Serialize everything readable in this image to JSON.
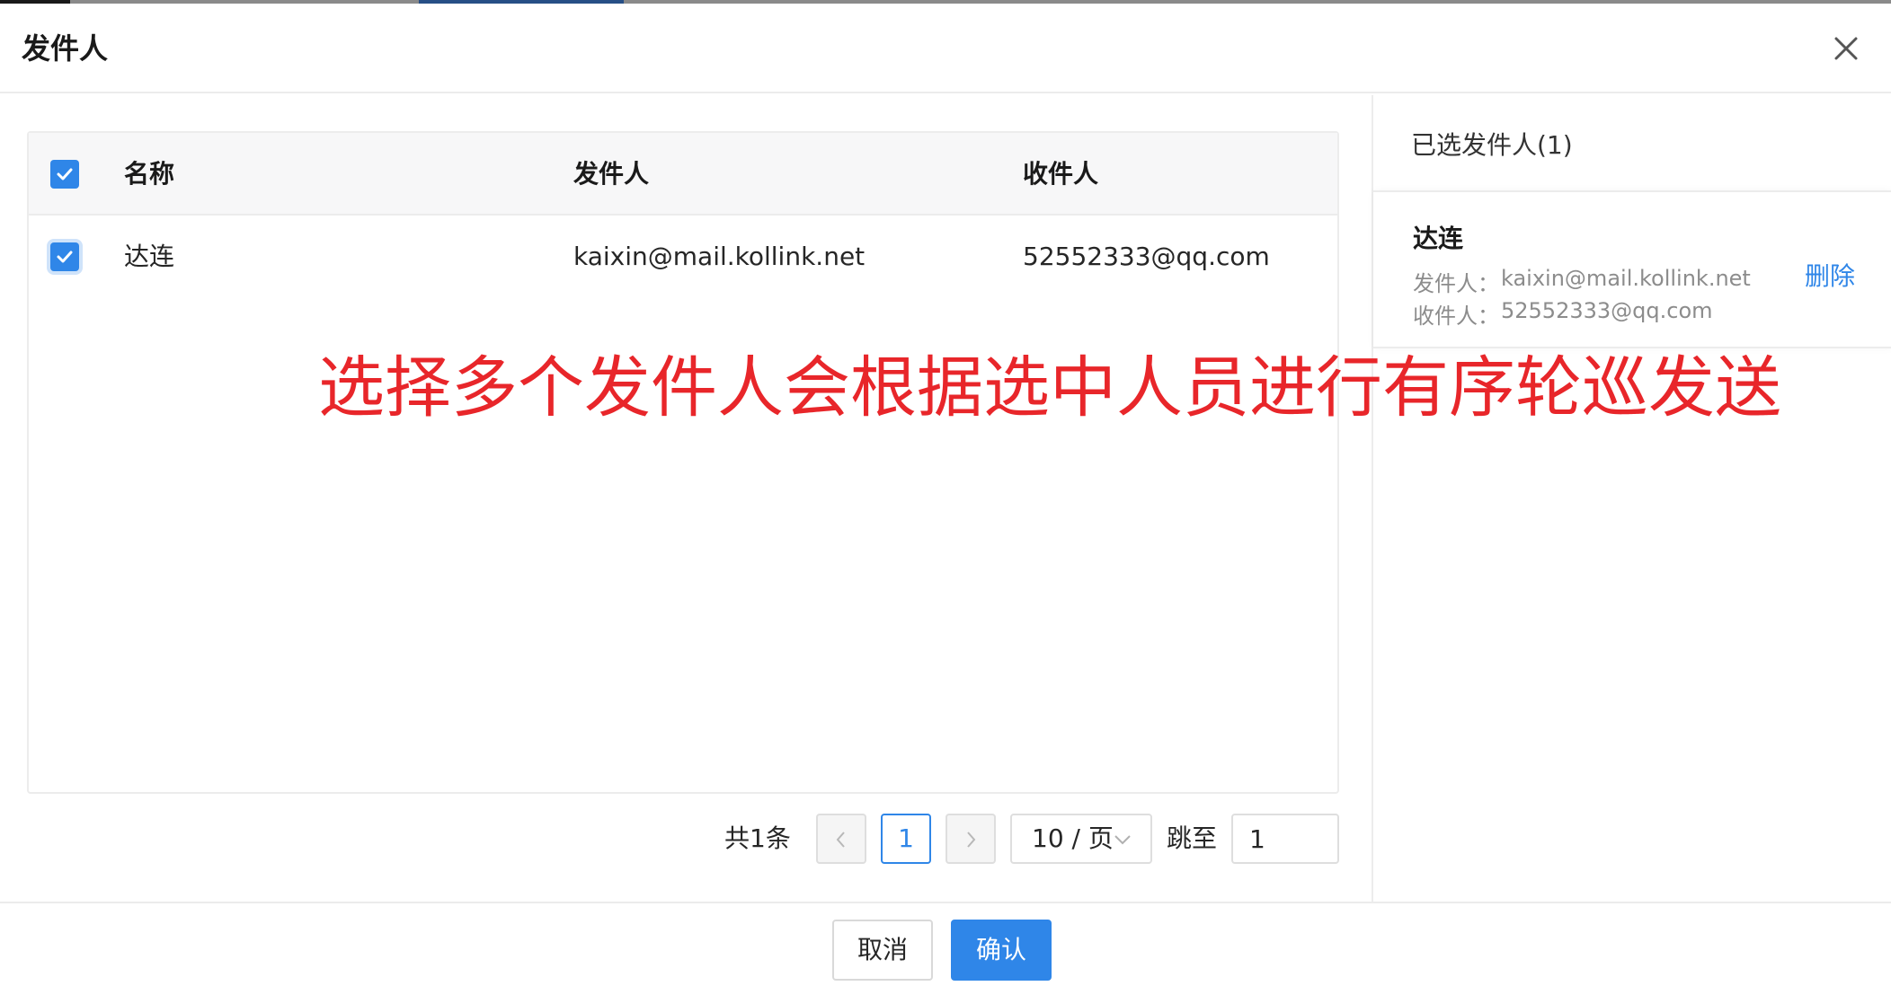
{
  "modal": {
    "title": "发件人",
    "close_icon": "close-icon"
  },
  "table": {
    "columns": [
      "名称",
      "发件人",
      "收件人"
    ],
    "rows": [
      {
        "name": "达连",
        "sender": "kaixin@mail.kollink.net",
        "recipient": "52552333@qq.com",
        "checked": true
      }
    ]
  },
  "pagination": {
    "total": "共1条",
    "current_page": "1",
    "page_size": "10 / 页",
    "jump_label": "跳至",
    "jump_value": "1"
  },
  "selected": {
    "title": "已选发件人(1)",
    "items": [
      {
        "name": "达连",
        "sender_label": "发件人：",
        "sender": "kaixin@mail.kollink.net",
        "recipient_label": "收件人：",
        "recipient": "52552333@qq.com",
        "delete_label": "删除"
      }
    ]
  },
  "footer": {
    "cancel_label": "取消",
    "ok_label": "确认"
  },
  "annotation": "选择多个发件人会根据选中人员进行有序轮巡发送",
  "colors": {
    "primary": "#2f86e8",
    "annotation": "#e8262a"
  }
}
